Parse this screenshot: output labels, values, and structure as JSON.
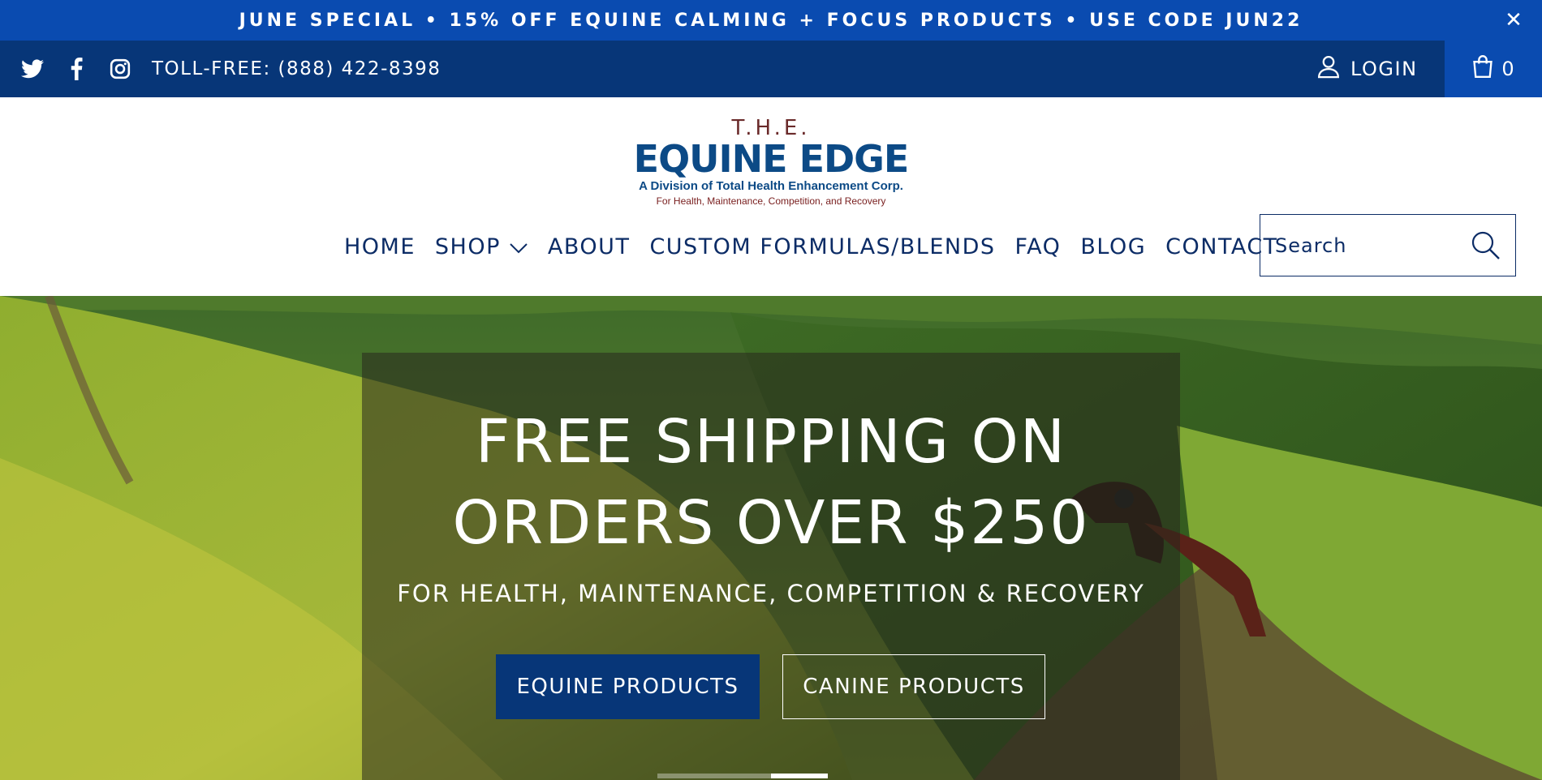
{
  "promo": {
    "text": "JUNE SPECIAL • 15% OFF EQUINE CALMING + FOCUS PRODUCTS • USE CODE JUN22",
    "close_label": "✕"
  },
  "topbar": {
    "social_icons": [
      "twitter-icon",
      "facebook-icon",
      "instagram-icon"
    ],
    "tollfree": "TOLL-FREE: (888) 422-8398",
    "login_label": "LOGIN",
    "cart_count": "0"
  },
  "logo": {
    "the": "T.H.E.",
    "main": "EQUINE EDGE",
    "division": "A Division of Total Health Enhancement Corp.",
    "tagline": "For Health, Maintenance, Competition, and Recovery"
  },
  "nav": {
    "items": [
      {
        "label": "HOME"
      },
      {
        "label": "SHOP"
      },
      {
        "label": "ABOUT"
      },
      {
        "label": "CUSTOM FORMULAS/BLENDS"
      },
      {
        "label": "FAQ"
      },
      {
        "label": "BLOG"
      },
      {
        "label": "CONTACT"
      }
    ]
  },
  "search": {
    "placeholder": "Search"
  },
  "hero": {
    "title_line1": "FREE SHIPPING ON",
    "title_line2": "ORDERS OVER $250",
    "subtitle": "FOR HEALTH, MAINTENANCE, COMPETITION & RECOVERY",
    "btn_equine": "EQUINE PRODUCTS",
    "btn_canine": "CANINE PRODUCTS",
    "slides_total": 3,
    "slide_active": 3
  },
  "colors": {
    "promo_bg": "#0a4bb0",
    "topbar_bg": "#073678",
    "nav_text": "#0c2c66",
    "button_primary": "#073678"
  }
}
